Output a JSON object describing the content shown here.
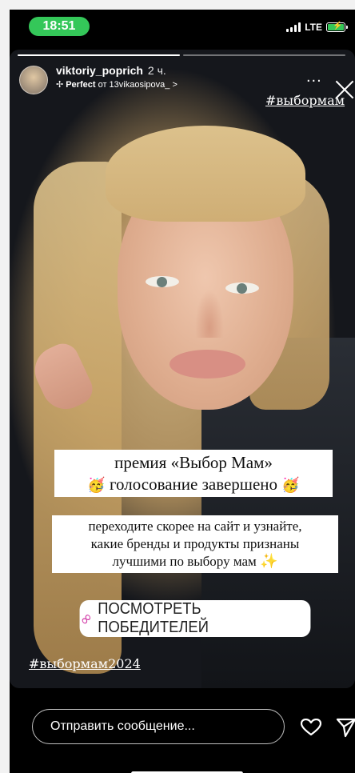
{
  "status_bar": {
    "time": "18:51",
    "network": "LTE",
    "signal_bars": 4,
    "battery_charging": true,
    "colors": {
      "time_pill": "#34c759",
      "battery": "#34c759"
    }
  },
  "story": {
    "segments": [
      {
        "progress": 1.0
      },
      {
        "progress": 0.0
      }
    ],
    "header": {
      "username": "viktoriy_poprich",
      "time_ago": "2 ч.",
      "music_icon": "sparkle-icon",
      "music_track": "Perfect",
      "music_from": "от 13vikaosipova_",
      "music_chevron": ">",
      "more_label": "...",
      "close_icon": "close-icon"
    },
    "hashtag_top": "#выбормам",
    "caption_lines": {
      "line1": "премия «Выбор Мам»",
      "line2": "голосование завершено",
      "line2_emoji": "🥳"
    },
    "caption2_lines": {
      "line1": "переходите скорее на сайт и узнайте,",
      "line2": "какие бренды и продукты признаны",
      "line3": "лучшими по выбору мам",
      "line3_emoji": "✨"
    },
    "link_button": {
      "icon": "link-icon",
      "label": "ПОСМОТРЕТЬ ПОБЕДИТЕЛЕЙ"
    },
    "hashtag_bottom": "#выбормам2024"
  },
  "footer": {
    "message_placeholder": "Отправить сообщение...",
    "like_icon": "heart-icon",
    "share_icon": "send-icon"
  }
}
